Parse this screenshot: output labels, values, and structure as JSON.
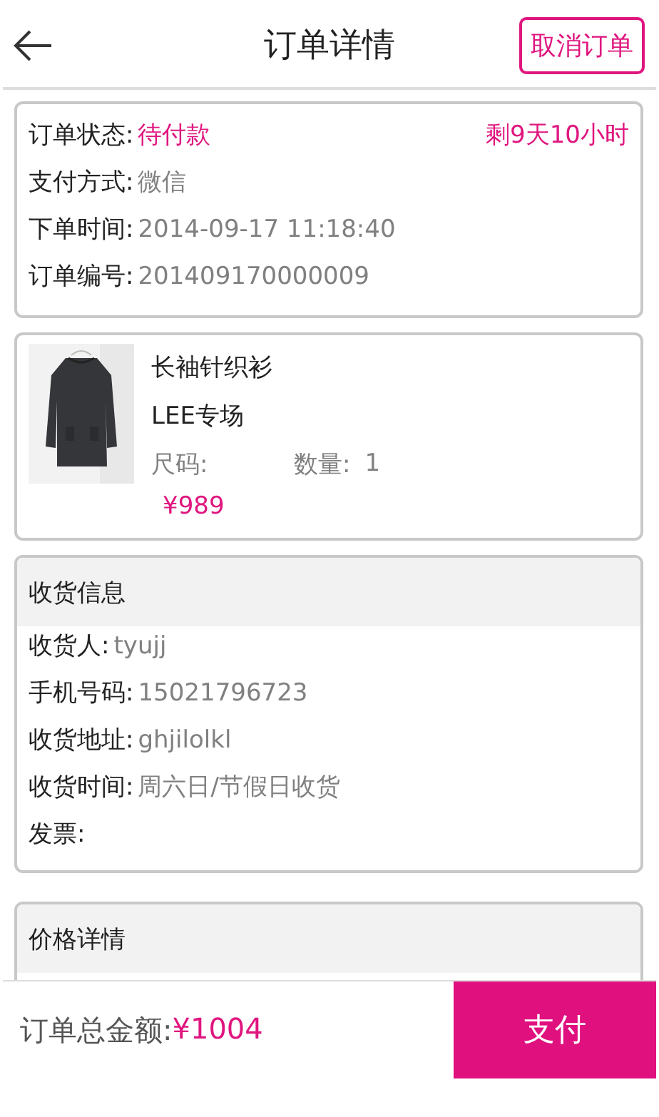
{
  "header": {
    "title": "订单详情",
    "cancel_button": "取消订单"
  },
  "order_info": {
    "countdown": "剩9天10小时",
    "rows": [
      {
        "label": "订单状态:",
        "value": "待付款",
        "kind": "status"
      },
      {
        "label": "支付方式:",
        "value": "微信",
        "kind": "plain"
      },
      {
        "label": "下单时间:",
        "value": "2014-09-17 11:18:40",
        "kind": "plain"
      },
      {
        "label": "订单编号:",
        "value": "201409170000009",
        "kind": "plain"
      }
    ]
  },
  "product": {
    "name": "长袖针织衫",
    "brand": "LEE专场",
    "size_label": "尺码:",
    "quantity_label": "数量:",
    "quantity": "1",
    "price": "¥989"
  },
  "shipping": {
    "title": "收货信息",
    "rows": [
      {
        "label": "收货人:",
        "value": "tyujj"
      },
      {
        "label": "手机号码:",
        "value": "15021796723"
      },
      {
        "label": "收货地址:",
        "value": "ghjilolkl"
      },
      {
        "label": "收货时间:",
        "value": "周六日/节假日收货"
      },
      {
        "label": "发票:"
      }
    ]
  },
  "price_details": {
    "title": "价格详情"
  },
  "footer": {
    "total_label": "订单总金额:",
    "total": "¥1004",
    "pay_button": "支付"
  }
}
